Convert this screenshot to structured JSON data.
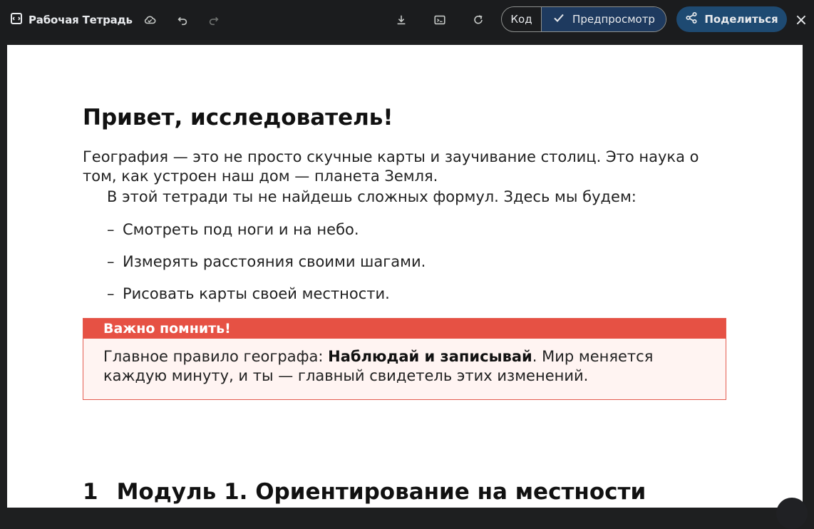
{
  "toolbar": {
    "title": "Рабочая Тетрадь",
    "code_label": "Код",
    "preview_label": "Предпросмотр",
    "share_label": "Поделиться",
    "close_glyph": "×"
  },
  "document": {
    "title": "Привет, исследователь!",
    "intro_line": "География — это не просто скучные карты и заучивание столиц. Это наука о том, как устроен наш дом — планета Земля.",
    "intro_indent": "В этой тетради ты не найдешь сложных формул. Здесь мы будем:",
    "bullets": [
      "Смотреть под ноги и на небо.",
      "Измерять расстояния своими шагами.",
      "Рисовать карты своей местности."
    ],
    "bullet_marker": "–",
    "callout": {
      "title": "Важно помнить!",
      "text_before": "Главное правило географа: ",
      "text_bold": "Наблюдай и записывай",
      "text_after": ". Мир меняется каждую минуту, и ты — главный свидетель этих изменений."
    },
    "module": {
      "number": "1",
      "title": "Модуль 1. Ориентирование на местности"
    }
  },
  "colors": {
    "accent_blue": "#1e4a72",
    "callout_red": "#e65144",
    "callout_bg": "#fff4f2"
  }
}
